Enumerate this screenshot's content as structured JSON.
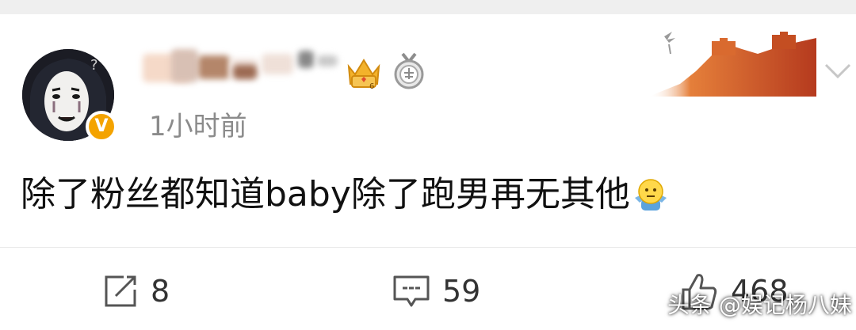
{
  "post": {
    "timestamp": "1小时前",
    "text": "除了粉丝都知道baby除了跑男再无其他",
    "verified_badge": "V"
  },
  "actions": {
    "repost_count": "8",
    "comment_count": "59",
    "like_count": "468"
  },
  "watermark": "头条 @娱记杨八妹",
  "icons": {
    "vip": "vip-crown-icon",
    "medal": "medal-icon",
    "repost": "repost-icon",
    "comment": "comment-icon",
    "like": "thumbs-up-icon",
    "chevron": "chevron-down-icon",
    "emoji": "shrug-emoji-icon"
  },
  "colors": {
    "verified": "#f4a300",
    "timestamp": "#8b8b8b",
    "text": "#111111"
  }
}
